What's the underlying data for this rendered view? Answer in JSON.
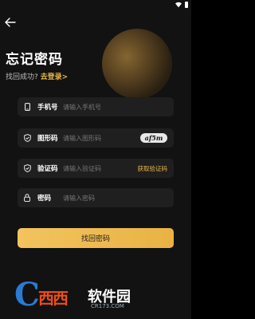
{
  "page": {
    "title": "忘记密码",
    "subtitle_text": "找回成功?",
    "subtitle_link": "去登录>"
  },
  "icons": {
    "back": "back-arrow-icon",
    "phone": "phone-icon",
    "shield": "shield-check-icon",
    "lock": "lock-icon"
  },
  "form": {
    "phone": {
      "label": "手机号",
      "placeholder": "请输入手机号"
    },
    "captcha": {
      "label": "图形码",
      "placeholder": "请输入图形码",
      "image_text": "af5m"
    },
    "code": {
      "label": "验证码",
      "placeholder": "请输入验证码",
      "action": "获取验证码"
    },
    "password": {
      "label": "密码",
      "placeholder": "请输入密码"
    }
  },
  "submit_label": "找回密码",
  "watermark": {
    "letter": "C",
    "west": "西西",
    "soft": "软件园",
    "url": "CR173.COM"
  },
  "colors": {
    "accent": "#e8b84a",
    "background": "#121212",
    "field": "#1f1f1f"
  }
}
